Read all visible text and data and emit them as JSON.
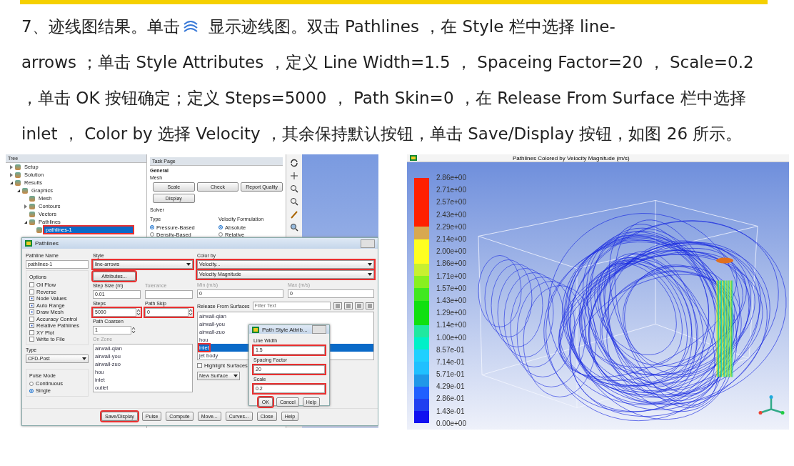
{
  "intro": {
    "before_icon": "7、迹线图结果。单击",
    "after_icon": "显示迹线图。双击 Pathlines ，在 Style 栏中选择 line-",
    "rest": "arrows ；单击 Style Attributes ，定义 Line Width=1.5 ， Spaceing Factor=20 ， Scale=0.2 ，单击 OK 按钮确定；定义 Steps=5000 ， Path Skin=0 ，在 Release From Surface 栏中选择 inlet ， Color by 选择 Velocity ，其余保持默认按钮，单击 Save/Display 按钮，如图 26 所示。"
  },
  "tree": {
    "title": "Tree",
    "items": [
      {
        "label": "Setup",
        "expanded": false
      },
      {
        "label": "Solution",
        "expanded": false
      },
      {
        "label": "Results",
        "expanded": true,
        "children": [
          {
            "label": "Graphics",
            "expanded": true,
            "children": [
              {
                "label": "Mesh"
              },
              {
                "label": "Contours",
                "expanded": false
              },
              {
                "label": "Vectors"
              },
              {
                "label": "Pathlines",
                "expanded": true,
                "children": [
                  {
                    "label": "pathlines-1",
                    "selected": true,
                    "highlighted": true
                  }
                ]
              }
            ]
          }
        ]
      }
    ]
  },
  "task_page": {
    "title": "Task Page",
    "heading": "General",
    "mesh_label": "Mesh",
    "mesh_buttons": [
      "Scale",
      "Check",
      "Report Quality",
      "Display"
    ],
    "solver_label": "Solver",
    "type_label": "Type",
    "type_options": [
      {
        "label": "Pressure-Based",
        "selected": true
      },
      {
        "label": "Density-Based",
        "selected": false
      }
    ],
    "velocity_label": "Velocity Formulation",
    "velocity_options": [
      {
        "label": "Absolute",
        "selected": true
      },
      {
        "label": "Relative",
        "selected": false
      }
    ]
  },
  "dialog": {
    "title": "Pathlines",
    "name_label": "Pathline Name",
    "name_value": "pathlines-1",
    "options_label": "Options",
    "options": [
      {
        "label": "Oil Flow",
        "checked": false
      },
      {
        "label": "Reverse",
        "checked": false
      },
      {
        "label": "Node Values",
        "checked": true
      },
      {
        "label": "Auto Range",
        "checked": true
      },
      {
        "label": "Draw Mesh",
        "checked": true
      },
      {
        "label": "Accuracy Control",
        "checked": false
      },
      {
        "label": "Relative Pathlines",
        "checked": true
      },
      {
        "label": "XY Plot",
        "checked": false
      },
      {
        "label": "Write to File",
        "checked": false
      }
    ],
    "type_label": "Type",
    "type_value": "CFD-Post",
    "pulse_label": "Pulse Mode",
    "pulse_options": [
      {
        "label": "Continuous",
        "selected": false
      },
      {
        "label": "Single",
        "selected": true
      }
    ],
    "style_label": "Style",
    "style_value": "line-arrows",
    "style_highlighted": true,
    "attributes_button": "Attributes...",
    "attributes_highlighted": true,
    "step_size_label": "Step Size (m)",
    "step_size_value": "0.01",
    "tolerance_label": "Tolerance",
    "steps_label": "Steps",
    "steps_value": "5000",
    "steps_highlighted": true,
    "path_skip_label": "Path Skip",
    "path_skip_value": "0",
    "path_skip_highlighted": true,
    "coarsen_label": "Path Coarsen",
    "coarsen_value": "1",
    "zone_label": "On Zone",
    "zones": [
      "airwall-qian",
      "airwall-you",
      "airwall-zuo",
      "hou",
      "inlet",
      "outlet"
    ],
    "color_by_label": "Color by",
    "color_by": [
      {
        "value": "Velocity...",
        "highlighted": true
      },
      {
        "value": "Velocity Magnitude",
        "highlighted": true
      }
    ],
    "min_label": "Min (m/s)",
    "min_value": "0",
    "max_label": "Max (m/s)",
    "max_value": "0",
    "release_label": "Release From Surfaces",
    "filter_placeholder": "Filter Text",
    "surfaces": [
      {
        "label": "airwall-qian",
        "selected": false
      },
      {
        "label": "airwall-you",
        "selected": false
      },
      {
        "label": "airwall-zuo",
        "selected": false
      },
      {
        "label": "hou",
        "selected": false
      },
      {
        "label": "inlet",
        "selected": true,
        "highlighted": true
      },
      {
        "label": "jet body",
        "selected": false
      }
    ],
    "highlight_label": "Highlight Surfaces",
    "highlight_checked": false,
    "new_surface": "New Surface",
    "buttons": [
      {
        "label": "Save/Display",
        "highlighted": true
      },
      {
        "label": "Pulse"
      },
      {
        "label": "Compute"
      },
      {
        "label": "Move..."
      },
      {
        "label": "Curves..."
      },
      {
        "label": "Close"
      },
      {
        "label": "Help"
      }
    ]
  },
  "style_dialog": {
    "title": "Path Style Attrib...",
    "fields": [
      {
        "label": "Line Width",
        "value": "1.5",
        "highlighted": true
      },
      {
        "label": "Spacing Factor",
        "value": "20",
        "highlighted": true
      },
      {
        "label": "Scale",
        "value": "0.2",
        "highlighted": true
      }
    ],
    "buttons": [
      {
        "label": "OK",
        "highlighted": true
      },
      {
        "label": "Cancel"
      },
      {
        "label": "Help"
      }
    ]
  },
  "plot": {
    "title": "Pathlines Colored by Velocity Magnitude (m/s)",
    "legend_labels": [
      "2.86e+00",
      "2.71e+00",
      "2.57e+00",
      "2.43e+00",
      "2.29e+00",
      "2.14e+00",
      "2.00e+00",
      "1.86e+00",
      "1.71e+00",
      "1.57e+00",
      "1.43e+00",
      "1.29e+00",
      "1.14e+00",
      "1.00e+00",
      "8.57e-01",
      "7.14e-01",
      "5.71e-01",
      "4.29e-01",
      "2.86e-01",
      "1.43e-01",
      "0.00e+00"
    ],
    "legend_bands": [
      {
        "color": "#ff2000"
      },
      {
        "color": "#ff2000"
      },
      {
        "color": "#ff2000"
      },
      {
        "color": "#ff2000"
      },
      {
        "color": "#d8a850"
      },
      {
        "color": "#ffff20"
      },
      {
        "color": "#ffff20"
      },
      {
        "color": "#c8f030"
      },
      {
        "color": "#88f020"
      },
      {
        "color": "#40e820"
      },
      {
        "color": "#10e010"
      },
      {
        "color": "#10e010"
      },
      {
        "color": "#20e8a0"
      },
      {
        "color": "#00f0c8"
      },
      {
        "color": "#20d0ff"
      },
      {
        "color": "#20c0ff"
      },
      {
        "color": "#2098e8"
      },
      {
        "color": "#2060ff"
      },
      {
        "color": "#2040f0"
      },
      {
        "color": "#1010f0"
      }
    ]
  }
}
